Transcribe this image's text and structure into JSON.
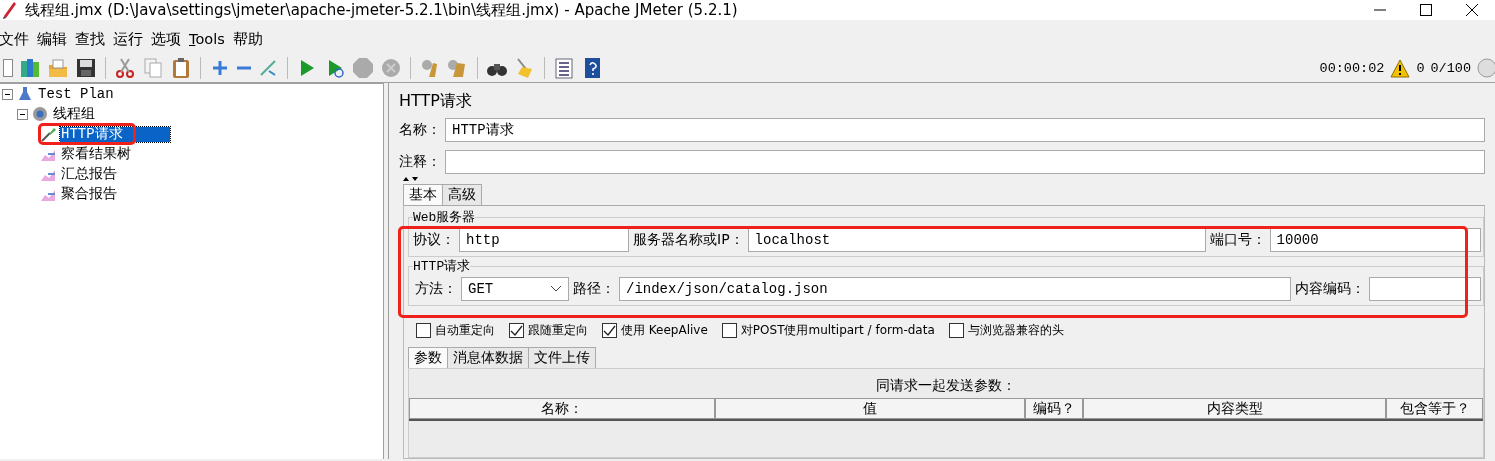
{
  "window": {
    "title": "线程组.jmx (D:\\Java\\settings\\jmeter\\apache-jmeter-5.2.1\\bin\\线程组.jmx) - Apache JMeter (5.2.1)"
  },
  "menu": [
    {
      "label": "文件"
    },
    {
      "label": "编辑"
    },
    {
      "label": "查找"
    },
    {
      "label": "运行"
    },
    {
      "label": "选项"
    },
    {
      "mnemonic": "T",
      "label": "ools"
    },
    {
      "label": "帮助"
    }
  ],
  "status": {
    "elapsed": "00:00:02",
    "warnings": "0",
    "threads": "0/100"
  },
  "tree": [
    {
      "label": "Test Plan",
      "kind": "test_plan",
      "expanded": true,
      "selected": false,
      "children": [
        {
          "label": "线程组",
          "kind": "thread_group",
          "expanded": true,
          "selected": false,
          "children": [
            {
              "label": "HTTP请求",
              "kind": "sampler",
              "selected": true
            },
            {
              "label": "察看结果树",
              "kind": "listener",
              "selected": false
            },
            {
              "label": "汇总报告",
              "kind": "listener",
              "selected": false
            },
            {
              "label": "聚合报告",
              "kind": "listener",
              "selected": false
            }
          ]
        }
      ]
    }
  ],
  "editor": {
    "title": "HTTP请求",
    "name_label": "名称：",
    "name_value": "HTTP请求",
    "comment_label": "注释：",
    "tabs": [
      {
        "label": "基本",
        "selected": true
      },
      {
        "label": "高级",
        "selected": false
      }
    ],
    "web_server": {
      "legend": "Web服务器",
      "protocol_label": "协议：",
      "protocol": "http",
      "server_label": "服务器名称或IP：",
      "server": "localhost",
      "port_label": "端口号：",
      "port": "10000"
    },
    "http_request": {
      "legend": "HTTP请求",
      "method_label": "方法：",
      "method": "GET",
      "path_label": "路径：",
      "path": "/index/json/catalog.json",
      "encoding_label": "内容编码："
    },
    "options": [
      {
        "label": "自动重定向",
        "checked": false
      },
      {
        "label": "跟随重定向",
        "checked": true
      },
      {
        "label": "使用 KeepAlive",
        "checked": true
      },
      {
        "label": "对POST使用multipart / form-data",
        "checked": false
      },
      {
        "label": "与浏览器兼容的头",
        "checked": false
      }
    ],
    "sub_tabs": [
      {
        "label": "参数",
        "selected": true
      },
      {
        "label": "消息体数据",
        "selected": false
      },
      {
        "label": "文件上传",
        "selected": false
      }
    ],
    "table": {
      "title": "同请求一起发送参数：",
      "columns": [
        "名称：",
        "值",
        "编码？",
        "内容类型",
        "包含等于？"
      ]
    }
  }
}
